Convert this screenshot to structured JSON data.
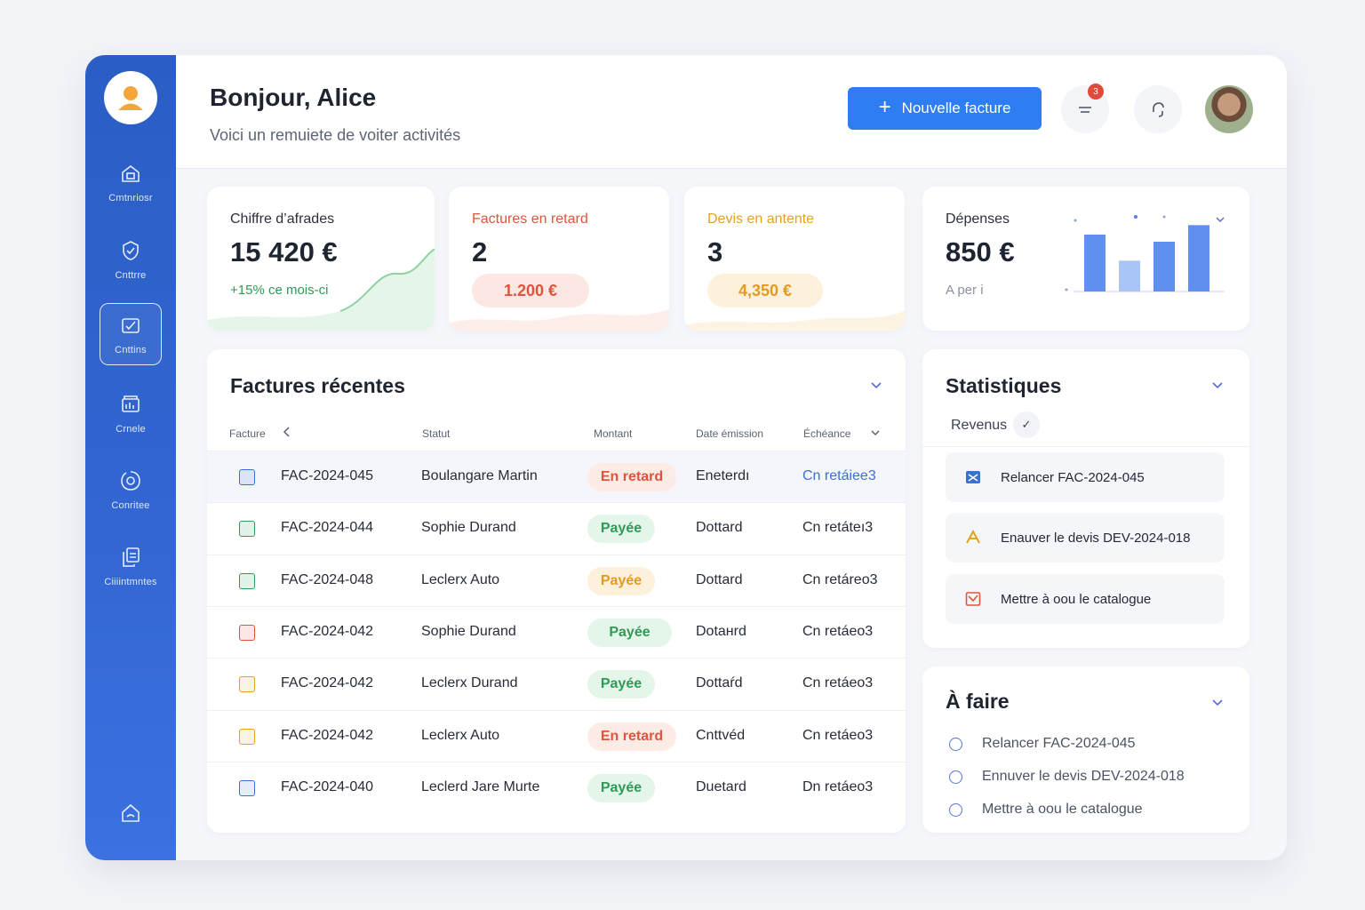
{
  "sidebar": {
    "items": [
      {
        "label": "Cmtnriosr"
      },
      {
        "label": "Cnttrre"
      },
      {
        "label": "Cnttins"
      },
      {
        "label": "Crnele"
      },
      {
        "label": "Conritee"
      },
      {
        "label": "Ciiiintmntes"
      }
    ]
  },
  "header": {
    "greeting": "Bonjour, Alice",
    "subtitle": "Voici un remuiete de voiter activités",
    "new_invoice": "Nouvelle facture",
    "notif_count": "3"
  },
  "stats": {
    "revenue": {
      "title": "Chiffre d’afrades",
      "value": "15 420 €",
      "note": "+15% ce mois-ci"
    },
    "late": {
      "title": "Factures en retard",
      "value": "2",
      "amount": "1.200 €"
    },
    "quotes": {
      "title": "Devis en antente",
      "value": "3",
      "amount": "4,350 €"
    },
    "expenses": {
      "title": "Dépenses",
      "value": "850 €",
      "note": "A per i"
    }
  },
  "colors": {
    "accent": "#2f7df2",
    "sidebar": "#2b5ec4",
    "late": "#e0533d",
    "paid": "#2f9a55",
    "pending": "#e39a22"
  },
  "invoices": {
    "title": "Factures récentes",
    "columns": {
      "facture": "Facture",
      "statut": "Statut",
      "montant": "Montant",
      "date": "Date émission",
      "due": "Échéance"
    },
    "rows": [
      {
        "id": "FAC-2024-045",
        "client": "Boulangare Martin",
        "status": "En retard",
        "date": "Eneterdı",
        "due": "Cn retáiee3",
        "icon_color": "#3a6fd8"
      },
      {
        "id": "FAC-2024-044",
        "client": "Sophie Durand",
        "status": "Payée",
        "date": "Dottard",
        "due": "Cn retáteı3",
        "icon_color": "#2f9a55"
      },
      {
        "id": "FAC-2024-048",
        "client": "Leclerx Auto",
        "status": "Payée",
        "date": "Dottard",
        "due": "Cn retáreo3",
        "icon_color": "#2f9a55"
      },
      {
        "id": "FAC-2024-042",
        "client": "Sophie Durand",
        "status": "Payée",
        "date": "Dotaнrd",
        "due": "Cn retáeo3",
        "icon_color": "#e0533d"
      },
      {
        "id": "FAC-2024-042",
        "client": "Leclerx Durand",
        "status": "Payée",
        "date": "Dottaŕd",
        "due": "Cn retáeo3",
        "icon_color": "#e3a21f"
      },
      {
        "id": "FAC-2024-042",
        "client": "Leclerx Auto",
        "status": "En retard",
        "date": "Cnttvéd",
        "due": "Cn retáeo3",
        "icon_color": "#e3a21f"
      },
      {
        "id": "FAC-2024-040",
        "client": "Leclerd Jare Murte",
        "status": "Payée",
        "date": "Duetard",
        "due": "Dn retáeo3",
        "icon_color": "#3a6fd8"
      }
    ]
  },
  "statistics": {
    "title": "Statistiques",
    "filter": "Revenus",
    "items": [
      {
        "label": "Relancer FAC-2024-045"
      },
      {
        "label": "Enauver le devis DEV-2024-018"
      },
      {
        "label": "Mettre à oou le catalogue"
      }
    ]
  },
  "todo": {
    "title": "À faire",
    "items": [
      {
        "label": "Relancer FAC-2024-045"
      },
      {
        "label": "Ennuver le devis DEV-2024-018"
      },
      {
        "label": "Mettre à oou le catalogue"
      }
    ]
  },
  "chart_data": {
    "type": "bar",
    "categories": [
      "",
      "",
      "",
      ""
    ],
    "values": [
      48,
      26,
      42,
      56
    ],
    "ylim": [
      0,
      60
    ]
  }
}
